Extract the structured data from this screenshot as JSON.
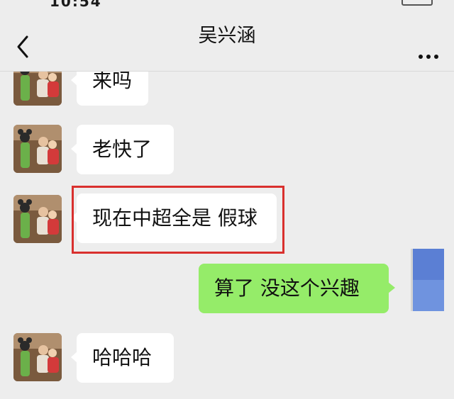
{
  "status_bar": {
    "time": "10:54"
  },
  "header": {
    "title": "吴兴涵",
    "back_icon": "chevron-left-icon",
    "more_icon": "more-dots-icon"
  },
  "messages": [
    {
      "direction": "incoming",
      "text": "来吗"
    },
    {
      "direction": "incoming",
      "text": "老快了"
    },
    {
      "direction": "incoming",
      "text": "现在中超全是 假球",
      "highlighted": true
    },
    {
      "direction": "outgoing",
      "text": "算了 没这个兴趣"
    },
    {
      "direction": "incoming",
      "text": "哈哈哈"
    }
  ],
  "colors": {
    "background": "#ededed",
    "incoming_bubble": "#ffffff",
    "outgoing_bubble": "#95ec69",
    "highlight_border": "#d9302e",
    "self_avatar": "#5b7fd4"
  }
}
